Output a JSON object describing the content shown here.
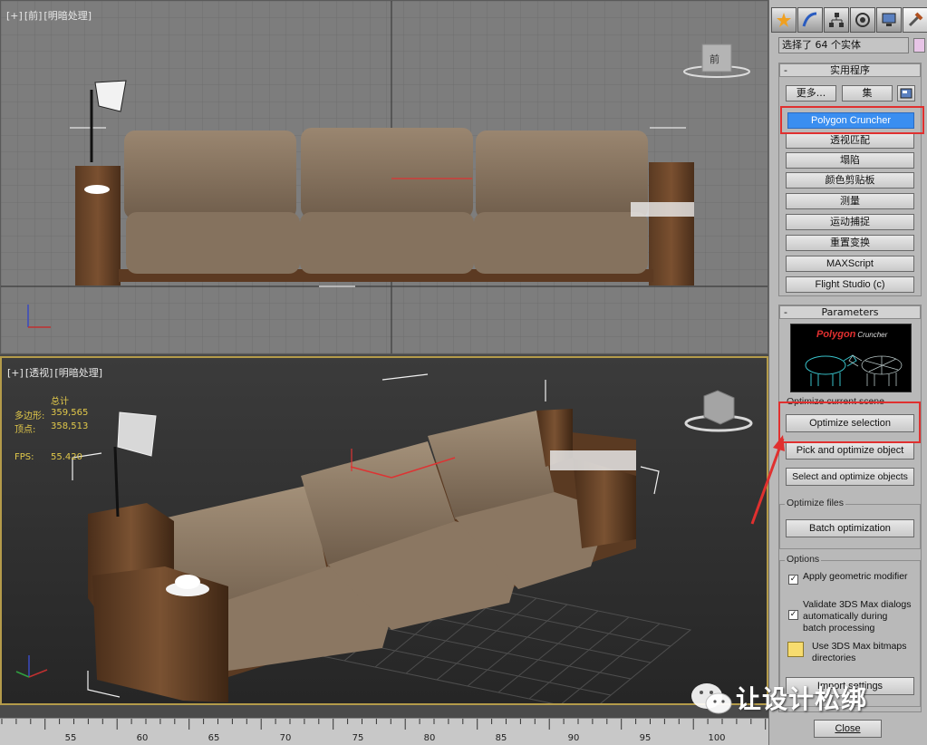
{
  "front_viewport": {
    "label": [
      "[+]",
      "[前]",
      "[明暗处理]"
    ],
    "viewcube_label": "前"
  },
  "persp_viewport": {
    "label": [
      "[+]",
      "[透视]",
      "[明暗处理]"
    ],
    "stats": {
      "header": "总计",
      "polys_label": "多边形:",
      "polys_value": "359,565",
      "verts_label": "顶点:",
      "verts_value": "358,513",
      "fps_label": "FPS:",
      "fps_value": "55.420"
    }
  },
  "timeline": {
    "labels": [
      "55",
      "60",
      "65",
      "70",
      "75",
      "80",
      "85",
      "90",
      "95",
      "100"
    ]
  },
  "panel": {
    "tabs": [
      "create-icon",
      "modify-icon",
      "hierarchy-icon",
      "motion-icon",
      "display-icon",
      "utilities-icon"
    ],
    "selection_text": "选择了 64 个实体",
    "utilities": {
      "header": "实用程序",
      "minus": "-",
      "more_label": "更多...",
      "sets_label": "集",
      "items": [
        "Polygon Cruncher",
        "透视匹配",
        "塌陷",
        "颜色剪贴板",
        "测量",
        "运动捕捉",
        "重置变换",
        "MAXScript",
        "Flight Studio (c)"
      ]
    },
    "parameters": {
      "header": "Parameters",
      "minus": "-",
      "logo_title": "Polygon",
      "logo_subtitle": "Cruncher",
      "optimize_scene_label": "Optimize current scene",
      "optimize_selection": "Optimize selection",
      "pick_optimize": "Pick and optimize object",
      "select_optimize": "Select and optimize objects",
      "optimize_files_label": "Optimize files",
      "batch_optimization": "Batch optimization",
      "options_label": "Options",
      "opt_apply": "Apply geometric modifier",
      "opt_validate_1": "Validate 3DS Max dialogs",
      "opt_validate_2": "automatically during",
      "opt_validate_3": "batch processing",
      "opt_bitmaps_1": "Use 3DS Max bitmaps",
      "opt_bitmaps_2": "directories",
      "import_label": "Import settings",
      "close_label": "Close"
    }
  },
  "watermark": {
    "text": "让设计松绑"
  },
  "colors": {
    "highlight_blue": "#3a8ef0",
    "annotation_red": "#e0302f",
    "stats_yellow": "#e1c84a"
  }
}
